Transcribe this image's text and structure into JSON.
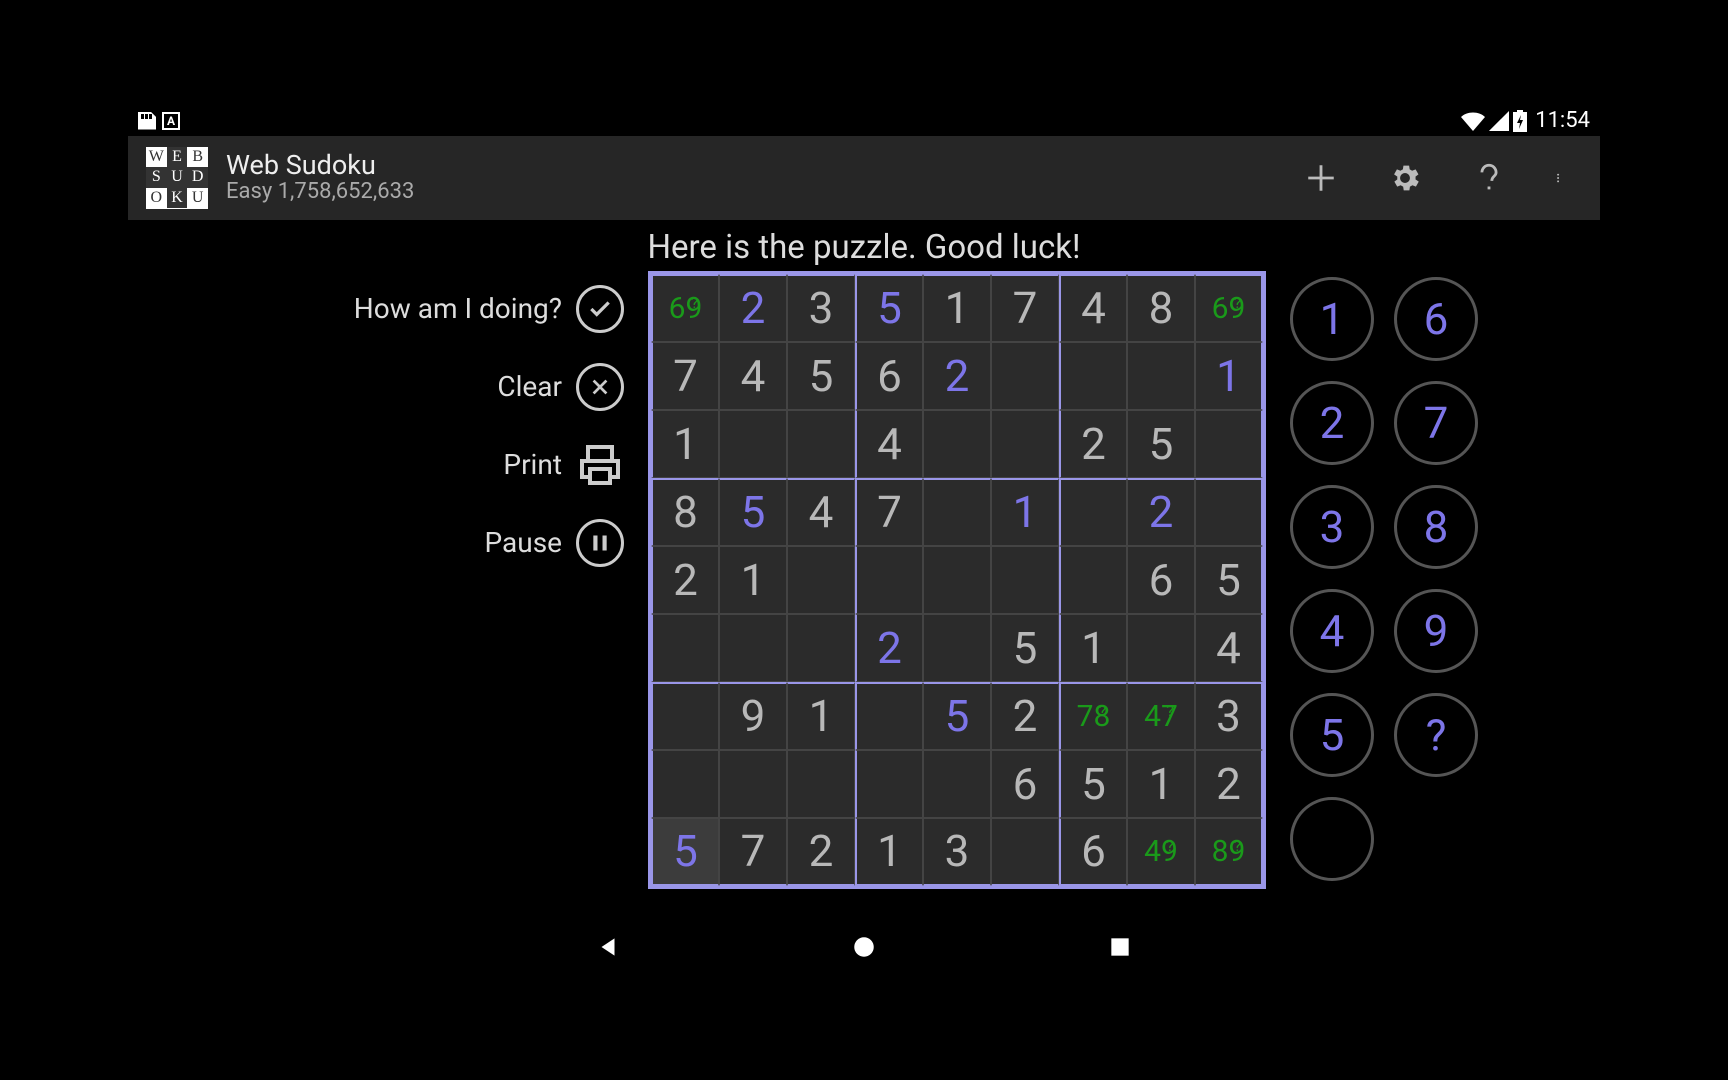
{
  "status": {
    "time": "11:54",
    "kb_letter": "A"
  },
  "app": {
    "title": "Web Sudoku",
    "subtitle": "Easy 1,758,652,633",
    "logo_cells": [
      "W",
      "E",
      "B",
      "S",
      "U",
      "D",
      "O",
      "K",
      "U"
    ],
    "logo_inv": [
      false,
      true,
      false,
      true,
      true,
      true,
      false,
      true,
      false
    ]
  },
  "greeting": "Here is the puzzle. Good luck!",
  "tools": {
    "how": "How am I doing?",
    "clear": "Clear",
    "print": "Print",
    "pause": "Pause"
  },
  "grid": [
    [
      {
        "t": "pencil",
        "v": "69"
      },
      {
        "t": "user",
        "v": "2"
      },
      {
        "t": "given",
        "v": "3"
      },
      {
        "t": "user",
        "v": "5"
      },
      {
        "t": "given",
        "v": "1"
      },
      {
        "t": "given",
        "v": "7"
      },
      {
        "t": "given",
        "v": "4"
      },
      {
        "t": "given",
        "v": "8"
      },
      {
        "t": "pencil",
        "v": "69"
      }
    ],
    [
      {
        "t": "given",
        "v": "7"
      },
      {
        "t": "given",
        "v": "4"
      },
      {
        "t": "given",
        "v": "5"
      },
      {
        "t": "given",
        "v": "6"
      },
      {
        "t": "user",
        "v": "2"
      },
      {
        "t": "",
        "v": ""
      },
      {
        "t": "",
        "v": ""
      },
      {
        "t": "",
        "v": ""
      },
      {
        "t": "user",
        "v": "1"
      }
    ],
    [
      {
        "t": "given",
        "v": "1"
      },
      {
        "t": "",
        "v": ""
      },
      {
        "t": "",
        "v": ""
      },
      {
        "t": "given",
        "v": "4"
      },
      {
        "t": "",
        "v": ""
      },
      {
        "t": "",
        "v": ""
      },
      {
        "t": "given",
        "v": "2"
      },
      {
        "t": "given",
        "v": "5"
      },
      {
        "t": "",
        "v": ""
      }
    ],
    [
      {
        "t": "given",
        "v": "8"
      },
      {
        "t": "user",
        "v": "5"
      },
      {
        "t": "given",
        "v": "4"
      },
      {
        "t": "given",
        "v": "7"
      },
      {
        "t": "",
        "v": ""
      },
      {
        "t": "user",
        "v": "1"
      },
      {
        "t": "",
        "v": ""
      },
      {
        "t": "user",
        "v": "2"
      },
      {
        "t": "",
        "v": ""
      }
    ],
    [
      {
        "t": "given",
        "v": "2"
      },
      {
        "t": "given",
        "v": "1"
      },
      {
        "t": "",
        "v": ""
      },
      {
        "t": "",
        "v": ""
      },
      {
        "t": "",
        "v": ""
      },
      {
        "t": "",
        "v": ""
      },
      {
        "t": "",
        "v": ""
      },
      {
        "t": "given",
        "v": "6"
      },
      {
        "t": "given",
        "v": "5"
      }
    ],
    [
      {
        "t": "",
        "v": ""
      },
      {
        "t": "",
        "v": ""
      },
      {
        "t": "",
        "v": ""
      },
      {
        "t": "user",
        "v": "2"
      },
      {
        "t": "",
        "v": ""
      },
      {
        "t": "given",
        "v": "5"
      },
      {
        "t": "given",
        "v": "1"
      },
      {
        "t": "",
        "v": ""
      },
      {
        "t": "given",
        "v": "4"
      }
    ],
    [
      {
        "t": "",
        "v": ""
      },
      {
        "t": "given",
        "v": "9"
      },
      {
        "t": "given",
        "v": "1"
      },
      {
        "t": "",
        "v": ""
      },
      {
        "t": "user",
        "v": "5"
      },
      {
        "t": "given",
        "v": "2"
      },
      {
        "t": "pencil",
        "v": "78"
      },
      {
        "t": "pencil",
        "v": "47"
      },
      {
        "t": "given",
        "v": "3"
      }
    ],
    [
      {
        "t": "",
        "v": ""
      },
      {
        "t": "",
        "v": ""
      },
      {
        "t": "",
        "v": ""
      },
      {
        "t": "",
        "v": ""
      },
      {
        "t": "",
        "v": ""
      },
      {
        "t": "given",
        "v": "6"
      },
      {
        "t": "given",
        "v": "5"
      },
      {
        "t": "given",
        "v": "1"
      },
      {
        "t": "given",
        "v": "2"
      }
    ],
    [
      {
        "t": "user",
        "v": "5",
        "sel": true
      },
      {
        "t": "given",
        "v": "7"
      },
      {
        "t": "given",
        "v": "2"
      },
      {
        "t": "given",
        "v": "1"
      },
      {
        "t": "given",
        "v": "3"
      },
      {
        "t": "",
        "v": ""
      },
      {
        "t": "given",
        "v": "6"
      },
      {
        "t": "pencil",
        "v": "49"
      },
      {
        "t": "pencil",
        "v": "89"
      }
    ]
  ],
  "numpad": [
    "1",
    "6",
    "2",
    "7",
    "3",
    "8",
    "4",
    "9",
    "5",
    "?",
    "",
    ""
  ]
}
